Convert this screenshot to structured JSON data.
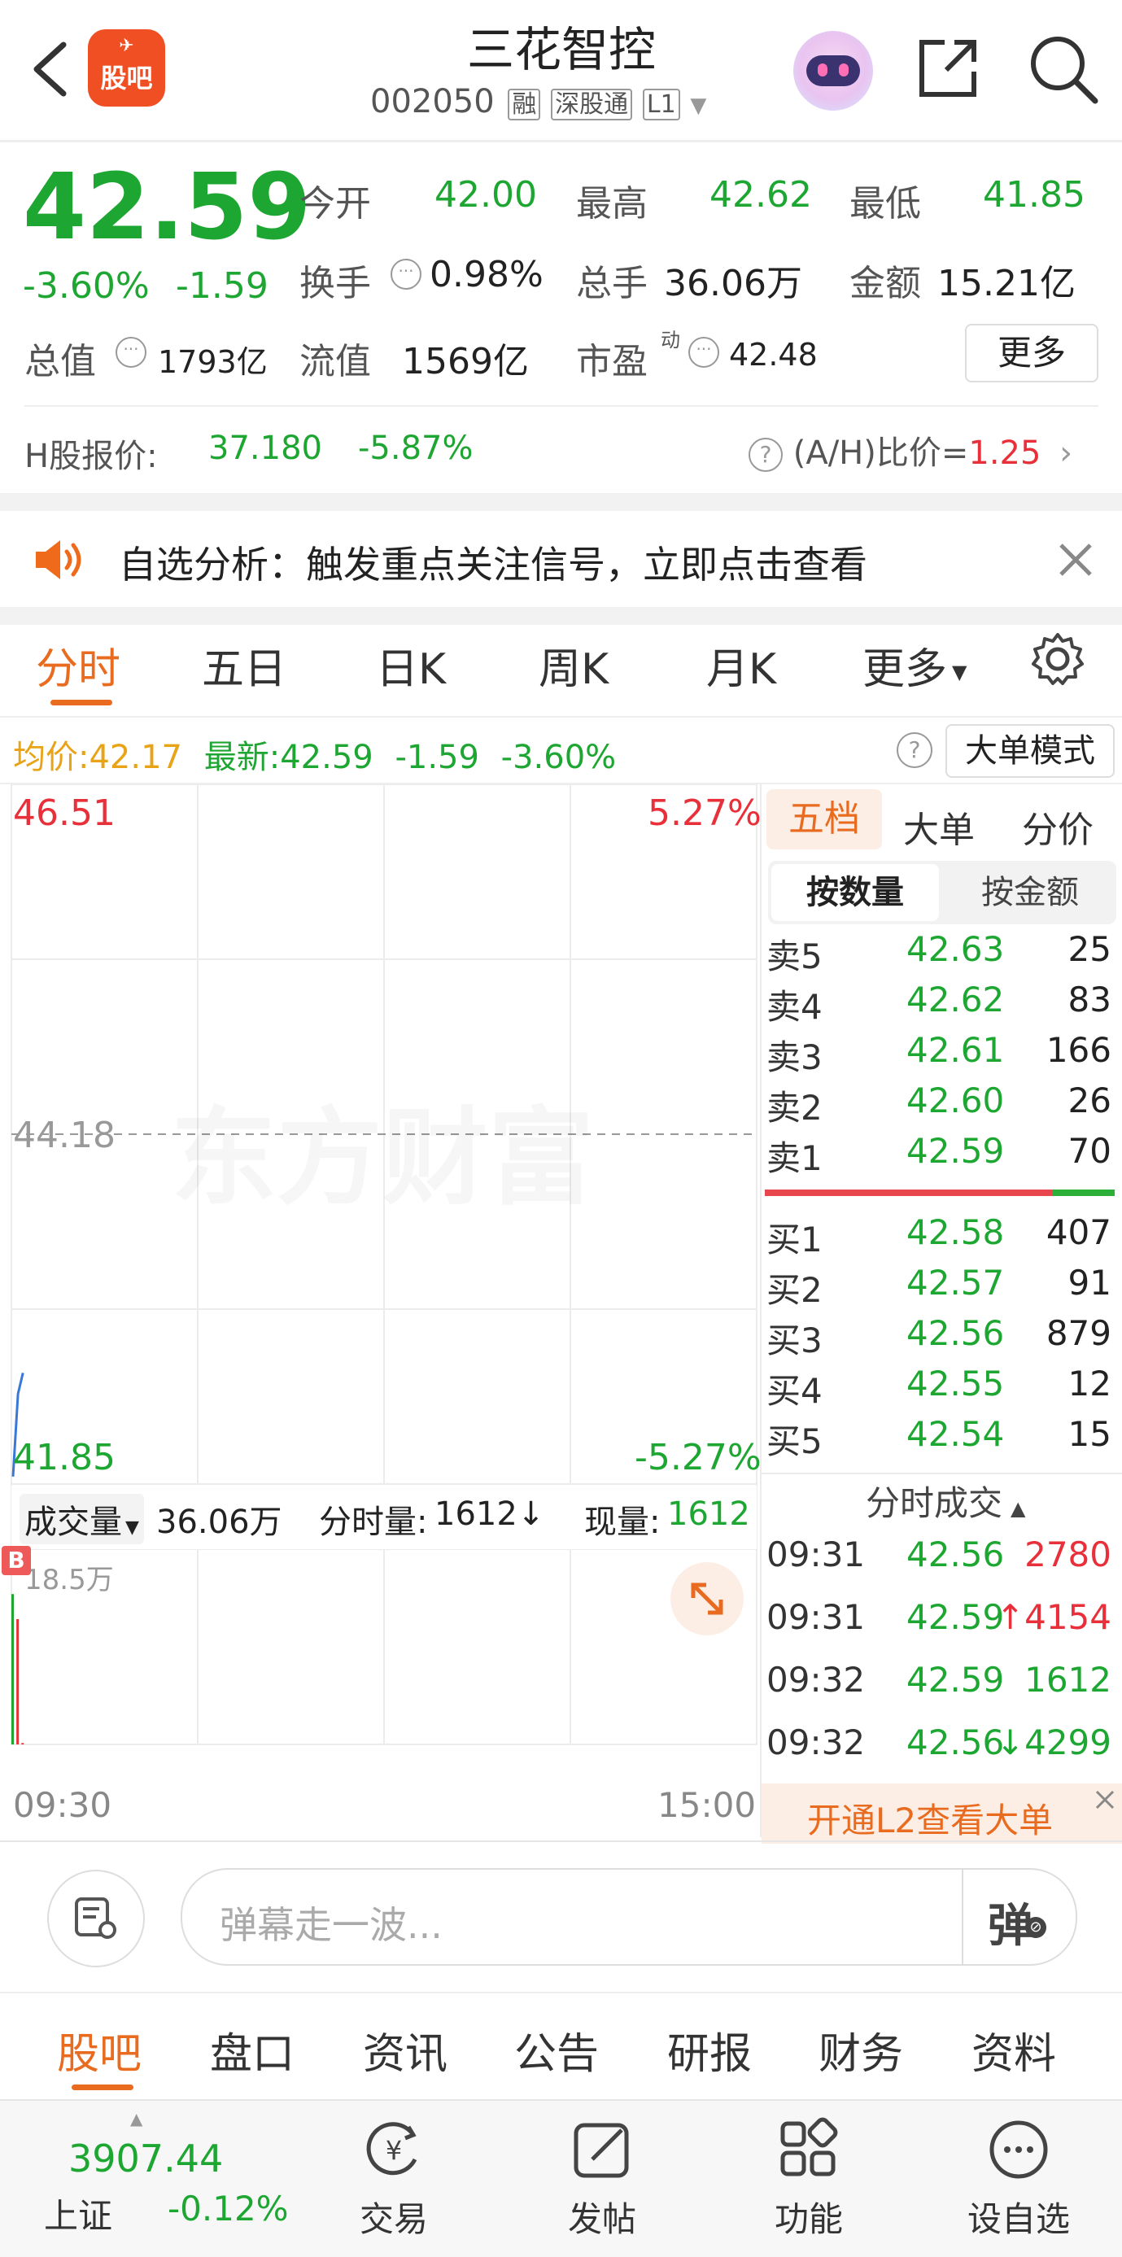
{
  "header": {
    "title": "三花智控",
    "code": "002050",
    "badges": [
      "融",
      "深股通",
      "L1"
    ],
    "logo_text": "股吧"
  },
  "quote": {
    "price": "42.59",
    "change_pct": "-3.60%",
    "change": "-1.59",
    "open_label": "今开",
    "open": "42.00",
    "high_label": "最高",
    "high": "42.62",
    "low_label": "最低",
    "low": "41.85",
    "turnover_label": "换手",
    "turnover": "0.98%",
    "volume_label": "总手",
    "volume": "36.06万",
    "amount_label": "金额",
    "amount": "15.21亿",
    "mktcap_label": "总值",
    "mktcap": "1793亿",
    "float_label": "流值",
    "float_cap": "1569亿",
    "pe_label": "市盈",
    "pe_sup": "动",
    "pe": "42.48",
    "more_label": "更多"
  },
  "hshare": {
    "label": "H股报价:",
    "price": "37.180",
    "pct": "-5.87%",
    "ratio_label": "(A/H)比价=",
    "ratio": "1.25"
  },
  "notice": {
    "text": "自选分析：触发重点关注信号，立即点击查看"
  },
  "tabs": [
    "分时",
    "五日",
    "日K",
    "周K",
    "月K",
    "更多"
  ],
  "legend": {
    "avg_label": "均价:",
    "avg": "42.17",
    "latest_label": "最新:",
    "latest": "42.59",
    "chg": "-1.59",
    "pct": "-3.60%",
    "bigorder_label": "大单模式"
  },
  "chart": {
    "top_price": "46.51",
    "top_pct": "5.27%",
    "mid_price": "44.18",
    "bottom_price": "41.85",
    "bottom_pct": "-5.27%",
    "watermark": "东方财富",
    "vol_label": "成交量",
    "vol_total": "36.06万",
    "vol_min_label": "分时量:",
    "vol_min": "1612↓",
    "vol_now_label": "现量:",
    "vol_now": "1612",
    "vol_max": "18.5万",
    "b_marker": "B",
    "time_start": "09:30",
    "time_end": "15:00"
  },
  "chart_data": {
    "type": "line",
    "x": [
      "09:30",
      "09:31",
      "09:32"
    ],
    "series": [
      {
        "values": [
          41.9,
          42.45,
          42.59
        ]
      }
    ],
    "ylim": [
      41.85,
      46.51
    ],
    "volume": [
      180000,
      150000,
      1612
    ]
  },
  "orderbook": {
    "tabs": [
      "五档",
      "大单",
      "分价"
    ],
    "subtabs": [
      "按数量",
      "按金额"
    ],
    "asks": [
      {
        "label": "卖5",
        "price": "42.63",
        "qty": "25"
      },
      {
        "label": "卖4",
        "price": "42.62",
        "qty": "83"
      },
      {
        "label": "卖3",
        "price": "42.61",
        "qty": "166"
      },
      {
        "label": "卖2",
        "price": "42.60",
        "qty": "26"
      },
      {
        "label": "卖1",
        "price": "42.59",
        "qty": "70"
      }
    ],
    "bids": [
      {
        "label": "买1",
        "price": "42.58",
        "qty": "407"
      },
      {
        "label": "买2",
        "price": "42.57",
        "qty": "91"
      },
      {
        "label": "买3",
        "price": "42.56",
        "qty": "879"
      },
      {
        "label": "买4",
        "price": "42.55",
        "qty": "12"
      },
      {
        "label": "买5",
        "price": "42.54",
        "qty": "15"
      }
    ],
    "deals_title": "分时成交",
    "deals": [
      {
        "time": "09:31",
        "price": "42.56",
        "qty": "2780"
      },
      {
        "time": "09:31",
        "price": "42.59",
        "qty": "↑4154"
      },
      {
        "time": "09:32",
        "price": "42.59",
        "qty": "1612"
      },
      {
        "time": "09:32",
        "price": "42.56",
        "qty": "↓4299"
      }
    ],
    "l2_text": "开通L2查看大单"
  },
  "comment": {
    "placeholder": "弹幕走一波...",
    "dan_label": "弹"
  },
  "bottom_tabs": [
    "股吧",
    "盘口",
    "资讯",
    "公告",
    "研报",
    "财务",
    "资料"
  ],
  "footer": {
    "index_value": "3907.44",
    "index_name": "上证",
    "index_pct": "-0.12%",
    "items": [
      "交易",
      "发帖",
      "功能",
      "设自选"
    ]
  },
  "colors": {
    "up": "#e8303a",
    "down": "#1ea632",
    "accent": "#e86b1f",
    "avg_line": "#e8a317"
  }
}
